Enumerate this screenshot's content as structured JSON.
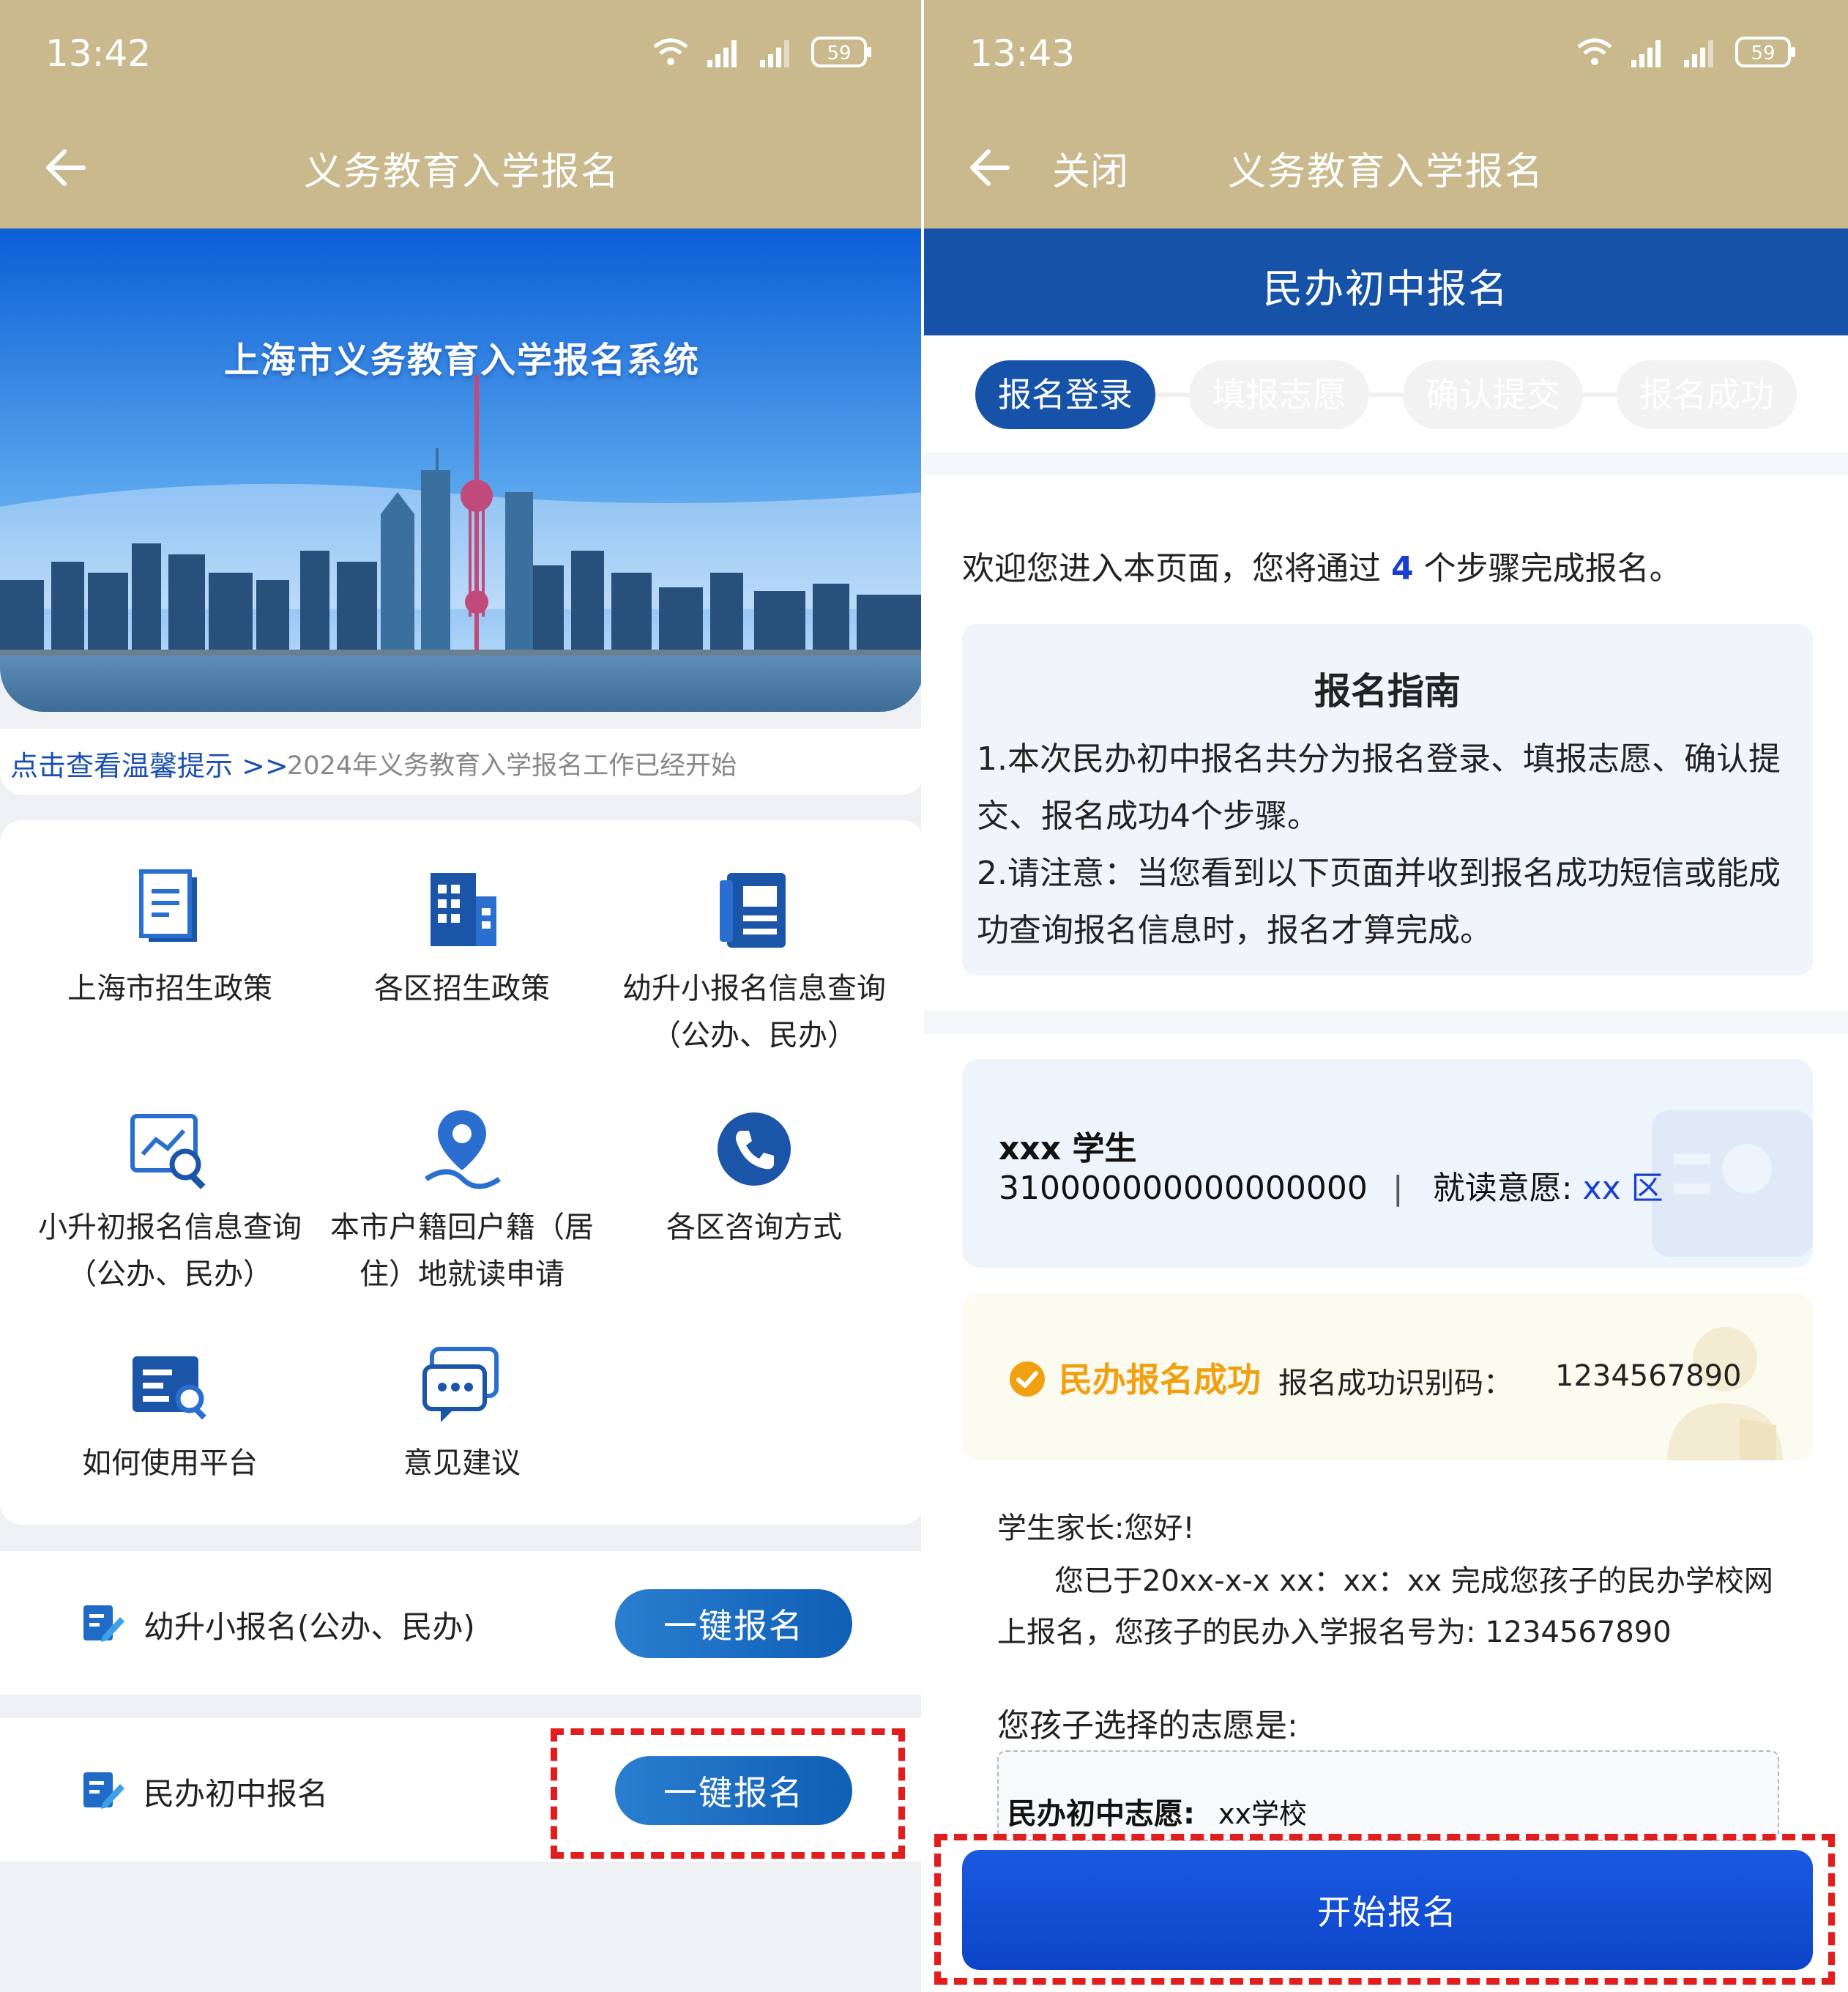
{
  "left": {
    "status": {
      "time": "13:42",
      "battery": "59"
    },
    "nav": {
      "title": "义务教育入学报名"
    },
    "banner": {
      "title": "上海市义务教育入学报名系统"
    },
    "notice": {
      "link": "点击查看温馨提示 >>",
      "text": "2024年义务教育入学报名工作已经开始"
    },
    "grid": [
      {
        "line1": "上海市招生政策",
        "line2": "",
        "icon": "policy-document-icon"
      },
      {
        "line1": "各区招生政策",
        "line2": "",
        "icon": "building-icon"
      },
      {
        "line1": "幼升小报名信息查询",
        "line2": "（公办、民办）",
        "icon": "notebook-icon"
      },
      {
        "line1": "小升初报名信息查询",
        "line2": "（公办、民办）",
        "icon": "search-chart-icon"
      },
      {
        "line1": "本市户籍回户籍（居",
        "line2": "住）地就读申请",
        "icon": "location-pin-icon"
      },
      {
        "line1": "各区咨询方式",
        "line2": "",
        "icon": "phone-icon"
      },
      {
        "line1": "如何使用平台",
        "line2": "",
        "icon": "guide-search-icon"
      },
      {
        "line1": "意见建议",
        "line2": "",
        "icon": "chat-bubble-icon"
      }
    ],
    "rows": [
      {
        "label": "幼升小报名(公办、民办)",
        "button": "一键报名"
      },
      {
        "label": "民办初中报名",
        "button": "一键报名"
      }
    ]
  },
  "right": {
    "status": {
      "time": "13:43",
      "battery": "59"
    },
    "nav": {
      "close": "关闭",
      "title": "义务教育入学报名"
    },
    "header": {
      "title": "民办初中报名"
    },
    "steps": [
      "报名登录",
      "填报志愿",
      "确认提交",
      "报名成功"
    ],
    "welcome": {
      "before": "欢迎您进入本页面，您将通过 ",
      "count": "4",
      "after": " 个步骤完成报名。"
    },
    "guide": {
      "title": "报名指南",
      "p1": "1.本次民办初中报名共分为报名登录、填报志愿、确认提交、报名成功4个步骤。",
      "p2": "2.请注意：当您看到以下页面并收到报名成功短信或能成功查询报名信息时，报名才算完成。"
    },
    "student": {
      "name": "xxx 学生",
      "id": "310000000000000000",
      "intent_label": "就读意愿: ",
      "intent_value": "xx 区"
    },
    "success": {
      "status": "民办报名成功",
      "code_label": "报名成功识别码：",
      "code": "1234567890"
    },
    "message": {
      "greeting": "学生家长:您好!",
      "line1": "您已于20xx-x-x xx：xx：xx 完成您孩子的民办学校网",
      "line2": "上报名，您孩子的民办入学报名号为: 1234567890",
      "choice_title": "您孩子选择的志愿是:",
      "choice_label": "民办初中志愿:",
      "choice_value": "xx学校"
    },
    "start_button": "开始报名"
  },
  "colors": {
    "header_gold": "#c9b98c",
    "primary_blue": "#1653a8",
    "highlight_red": "#e11d1d",
    "success_orange": "#f0a010"
  }
}
